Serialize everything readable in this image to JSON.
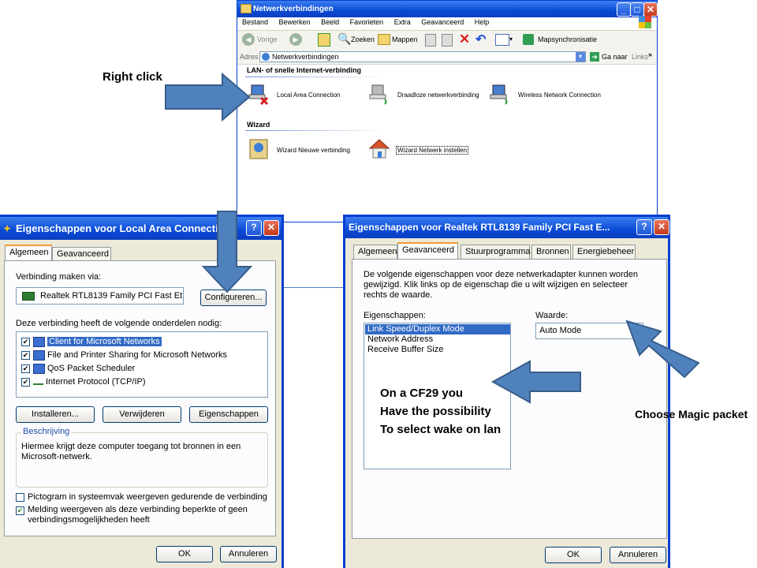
{
  "annotations": {
    "right_click": "Right click",
    "cf29_note": [
      "On a CF29 you",
      "Have the possibility",
      "To select wake on lan"
    ],
    "choose_magic": "Choose Magic packet"
  },
  "explorer": {
    "title": "Netwerkverbindingen",
    "menu": [
      "Bestand",
      "Bewerken",
      "Beeld",
      "Favorieten",
      "Extra",
      "Geavanceerd",
      "Help"
    ],
    "toolbar": {
      "back": "Vorige",
      "search": "Zoeken",
      "folders": "Mappen",
      "sync": "Mapsynchronisatie"
    },
    "address_label": "Adres",
    "address_value": "Netwerkverbindingen",
    "go_label": "Ga naar",
    "links_label": "Links",
    "section_lan": "LAN- of snelle Internet-verbinding",
    "lan_items": [
      "Local Area Connection",
      "Draadloze netwerkverbinding",
      "Wireless Network Connection"
    ],
    "section_wizard": "Wizard",
    "wizard_items": [
      "Wizard Nieuwe verbinding",
      "Wizard Netwerk instellen"
    ]
  },
  "dialog1": {
    "title": "Eigenschappen voor Local Area Connection",
    "tabs": [
      "Algemeen",
      "Geavanceerd"
    ],
    "connect_via_label": "Verbinding maken via:",
    "adapter_name": "Realtek RTL8139 Family PCI Fast Et",
    "configure_button": "Configureren...",
    "components_label": "Deze verbinding heeft de volgende onderdelen nodig:",
    "components": [
      "Client for Microsoft Networks",
      "File and Printer Sharing for Microsoft Networks",
      "QoS Packet Scheduler",
      "Internet Protocol (TCP/IP)"
    ],
    "install_button": "Installeren...",
    "remove_button": "Verwijderen",
    "properties_button": "Eigenschappen",
    "description_legend": "Beschrijving",
    "description_text": "Hiermee krijgt deze computer toegang tot bronnen in een Microsoft-netwerk.",
    "tray_icon_label": "Pictogram in systeemvak weergeven gedurende de verbinding",
    "notify_label": "Melding weergeven als deze verbinding beperkte of geen verbindingsmogelijkheden heeft",
    "ok_button": "OK",
    "cancel_button": "Annuleren"
  },
  "dialog2": {
    "title": "Eigenschappen voor Realtek RTL8139 Family PCI Fast E...",
    "tabs": [
      "Algemeen",
      "Geavanceerd",
      "Stuurprogramma",
      "Bronnen",
      "Energiebeheer"
    ],
    "intro_text": "De volgende eigenschappen voor deze netwerkadapter kunnen worden gewijzigd. Klik links op de eigenschap die u wilt wijzigen en selecteer rechts de waarde.",
    "properties_label": "Eigenschappen:",
    "properties": [
      "Link Speed/Duplex Mode",
      "Network Address",
      "Receive Buffer Size"
    ],
    "value_label": "Waarde:",
    "value": "Auto Mode",
    "ok_button": "OK",
    "cancel_button": "Annuleren"
  },
  "colors": {
    "xp_title": "#0a4ad6",
    "dialog_bg": "#ece9d8",
    "arrow_fill": "#4f81bd",
    "arrow_stroke": "#385d8a",
    "selection": "#316ac5"
  }
}
